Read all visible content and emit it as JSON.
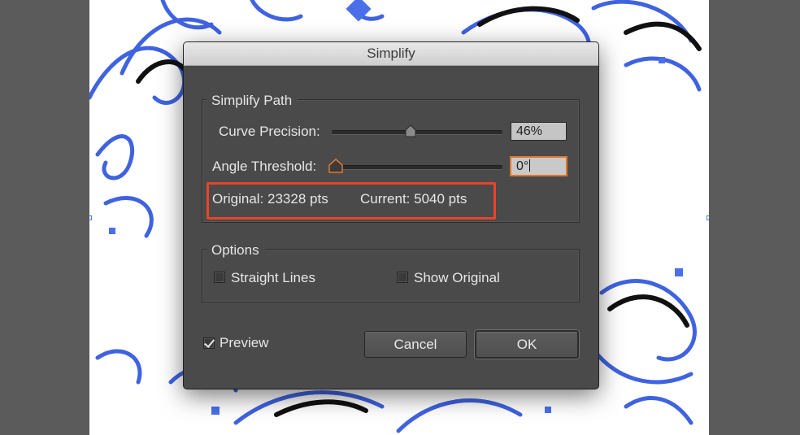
{
  "dialog": {
    "title": "Simplify",
    "simplify_path": {
      "legend": "Simplify Path",
      "curve_precision": {
        "label": "Curve Precision:",
        "value": "46%",
        "fraction": 0.46
      },
      "angle_threshold": {
        "label": "Angle Threshold:",
        "value": "0°",
        "fraction": 0.0
      },
      "original": "Original: 23328 pts",
      "current": "Current: 5040 pts"
    },
    "options": {
      "legend": "Options",
      "straight_lines": {
        "label": "Straight Lines",
        "checked": false
      },
      "show_original": {
        "label": "Show Original",
        "checked": false
      }
    },
    "preview": {
      "label": "Preview",
      "checked": true
    },
    "buttons": {
      "cancel": "Cancel",
      "ok": "OK"
    }
  },
  "colors": {
    "artwork": "#4169e1",
    "artwork_dark": "#111111",
    "highlight": "#e8452a",
    "focus": "#e0772e"
  }
}
